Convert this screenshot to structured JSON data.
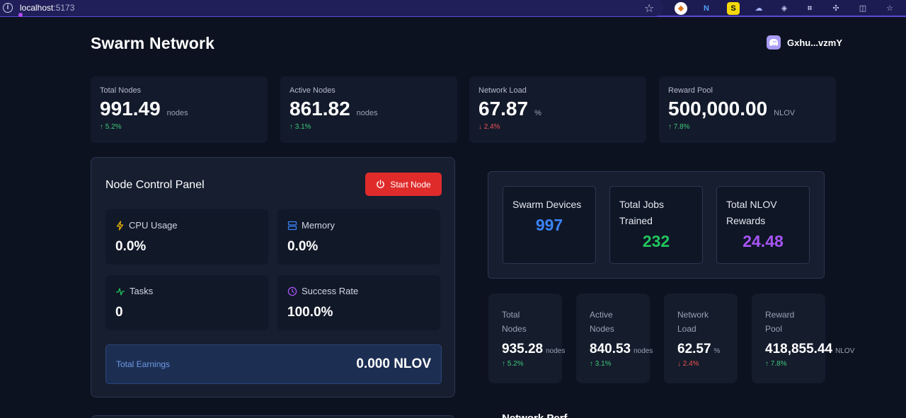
{
  "browser": {
    "url_host": "localhost",
    "url_port": ":5173"
  },
  "header": {
    "title": "Swarm Network",
    "wallet": "Gxhu...vzmY"
  },
  "top_stats": [
    {
      "label": "Total Nodes",
      "value": "991.49",
      "unit": "nodes",
      "change": "↑ 5.2%",
      "direction": "up"
    },
    {
      "label": "Active Nodes",
      "value": "861.82",
      "unit": "nodes",
      "change": "↑ 3.1%",
      "direction": "up"
    },
    {
      "label": "Network Load",
      "value": "67.87",
      "unit": "%",
      "change": "↓ 2.4%",
      "direction": "down"
    },
    {
      "label": "Reward Pool",
      "value": "500,000.00",
      "unit": "NLOV",
      "change": "↑ 7.8%",
      "direction": "up"
    }
  ],
  "control_panel": {
    "title": "Node Control Panel",
    "start_button": "Start Node",
    "metrics": [
      {
        "label": "CPU Usage",
        "value": "0.0%",
        "icon": "lightning-icon"
      },
      {
        "label": "Memory",
        "value": "0.0%",
        "icon": "server-icon"
      },
      {
        "label": "Tasks",
        "value": "0",
        "icon": "activity-icon"
      },
      {
        "label": "Success Rate",
        "value": "100.0%",
        "icon": "clock-icon"
      }
    ],
    "earnings_label": "Total Earnings",
    "earnings_value": "0.000 NLOV"
  },
  "summary": [
    {
      "label": "Swarm Devices",
      "value": "997",
      "color": "#3b82f6"
    },
    {
      "label": "Total Jobs Trained",
      "value": "232",
      "color": "#22c55e"
    },
    {
      "label": "Total NLOV Rewards",
      "value": "24.48",
      "color": "#a855f7"
    }
  ],
  "mini_stats": [
    {
      "label": "Total Nodes",
      "value": "935.28",
      "unit": "nodes",
      "change": "↑ 5.2%",
      "direction": "up"
    },
    {
      "label": "Active Nodes",
      "value": "840.53",
      "unit": "nodes",
      "change": "↑ 3.1%",
      "direction": "up"
    },
    {
      "label": "Network Load",
      "value": "62.57",
      "unit": "%",
      "change": "↓ 2.4%",
      "direction": "down"
    },
    {
      "label": "Reward Pool",
      "value": "418,855.44",
      "unit": "NLOV",
      "change": "↑ 7.8%",
      "direction": "up"
    }
  ],
  "section_next": "Network Perf"
}
